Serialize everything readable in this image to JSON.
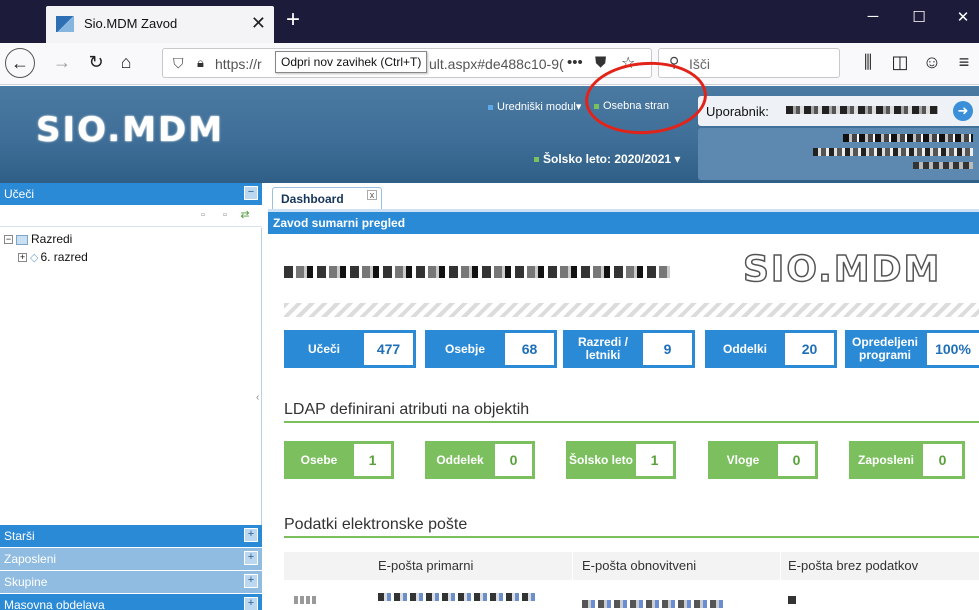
{
  "browser": {
    "tab_title": "Sio.MDM Zavod",
    "tab_close": "✕",
    "new_tab": "+",
    "window_controls": {
      "minimize": "─",
      "maximize": "☐",
      "close": "✕"
    },
    "url_prefix": "https://r",
    "url_suffix": "ult.aspx#de488c10-9(",
    "tooltip": "Odpri nov zavihek (Ctrl+T)",
    "url_more": "•••",
    "search_placeholder": "Išči",
    "icons": [
      "back-icon",
      "forward-icon",
      "reload-icon",
      "home-icon",
      "shield-icon",
      "lock-icon",
      "pocket-icon",
      "star-icon",
      "search-icon",
      "library-icon",
      "sidebar-icon",
      "account-icon",
      "menu-icon"
    ]
  },
  "header": {
    "logo": "SIO.MDM",
    "links": {
      "editor_module": "Uredniški modul▾",
      "personal_page": "Osebna stran",
      "school_year": "Šolsko leto: 2020/2021"
    },
    "user_label": "Uporabnik:",
    "colors": {
      "accent_blue": "#2b8ad6",
      "header_blue": "#3f6f98",
      "green": "#7bbf5f",
      "annotation_red": "#e2231a"
    }
  },
  "sidebar": {
    "title": "Učeči",
    "tree": [
      {
        "label": "Razredi",
        "level": 0,
        "expanded": true
      },
      {
        "label": "6. razred",
        "level": 1,
        "expanded": false
      }
    ],
    "accordion": [
      {
        "label": "Starši",
        "color": "#2b8ad6"
      },
      {
        "label": "Zaposleni",
        "color": "#8fbce0"
      },
      {
        "label": "Skupine",
        "color": "#8fbce0"
      },
      {
        "label": "Masovna obdelava",
        "color": "#2b8ad6"
      }
    ]
  },
  "main": {
    "tab_label": "Dashboard",
    "tab_close": "x",
    "panel_title": "Zavod sumarni pregled",
    "logo": "SIO.MDM",
    "stats": [
      {
        "label": "Učeči",
        "value": "477"
      },
      {
        "label": "Osebje",
        "value": "68"
      },
      {
        "label": "Razredi / letniki",
        "value": "9"
      },
      {
        "label": "Oddelki",
        "value": "20"
      },
      {
        "label": "Opredeljeni programi",
        "value": "100%"
      }
    ],
    "ldap_title": "LDAP definirani atributi na objektih",
    "ldap_stats": [
      {
        "label": "Osebe",
        "value": "1"
      },
      {
        "label": "Oddelek",
        "value": "0"
      },
      {
        "label": "Šolsko leto",
        "value": "1"
      },
      {
        "label": "Vloge",
        "value": "0"
      },
      {
        "label": "Zaposleni",
        "value": "0"
      }
    ],
    "email_title": "Podatki elektronske pošte",
    "email_columns": [
      "E-pošta primarni",
      "E-pošta obnovitveni",
      "E-pošta brez podatkov"
    ]
  }
}
